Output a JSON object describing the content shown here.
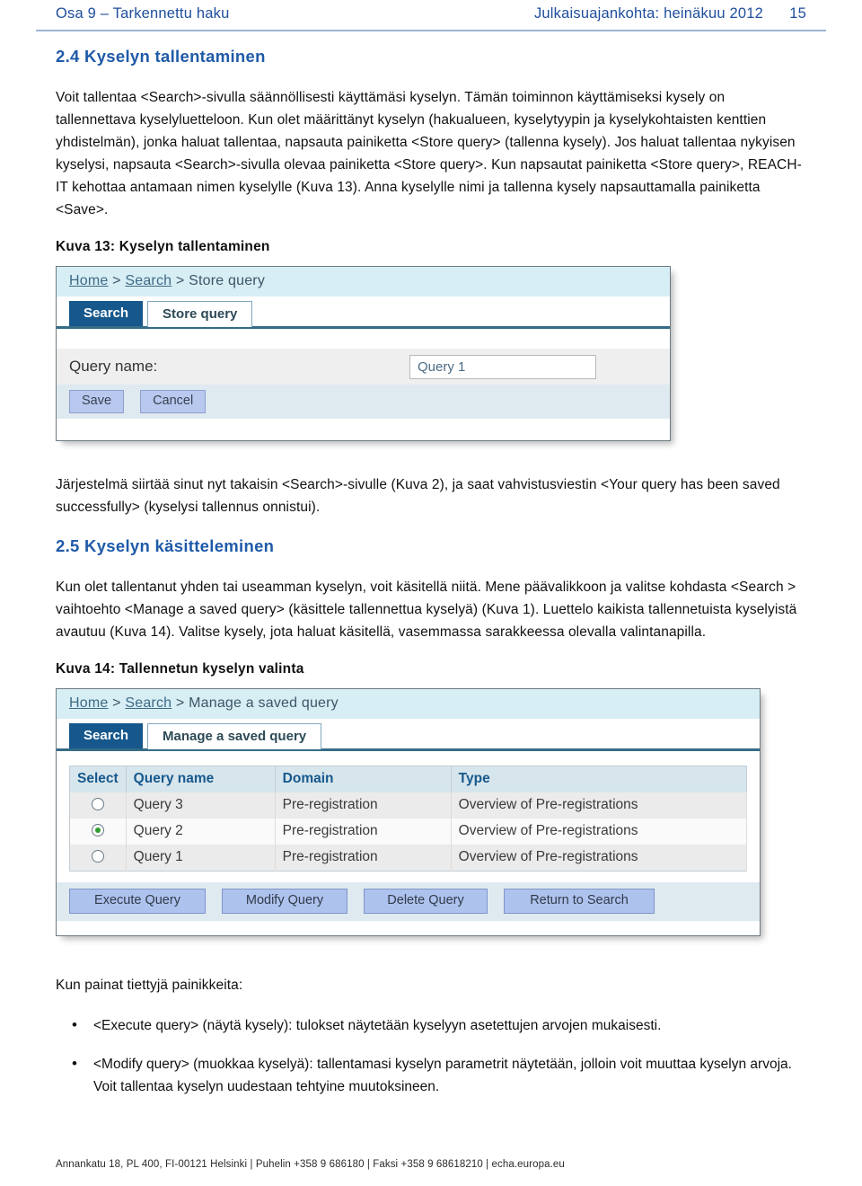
{
  "header": {
    "left": "Osa 9 – Tarkennettu haku",
    "right": "Julkaisuajankohta: heinäkuu 2012",
    "page_number": "15",
    "accent_color": "#1f4e9c"
  },
  "section_24": {
    "heading": "2.4 Kyselyn tallentaminen",
    "paragraph": "Voit tallentaa <Search>-sivulla säännöllisesti käyttämäsi kyselyn. Tämän toiminnon käyttämiseksi kysely on tallennettava kyselyluetteloon. Kun olet määrittänyt kyselyn (hakualueen, kyselytyypin ja kyselykohtaisten kenttien yhdistelmän), jonka haluat tallentaa, napsauta painiketta <Store query> (tallenna kysely). Jos haluat tallentaa nykyisen kyselysi, napsauta <Search>-sivulla olevaa painiketta <Store query>. Kun napsautat painiketta <Store query>, REACH-IT kehottaa antamaan nimen kyselylle (Kuva 13). Anna kyselylle nimi ja tallenna kysely napsauttamalla painiketta <Save>.",
    "figure_caption": "Kuva 13: Kyselyn tallentaminen",
    "after_figure_paragraph": "Järjestelmä siirtää sinut nyt takaisin <Search>-sivulle (Kuva 2), ja saat vahvistusviestin <Your query has been saved successfully> (kyselysi tallennus onnistui)."
  },
  "figure13": {
    "breadcrumb": {
      "home": "Home",
      "sep1": ">",
      "search": "Search",
      "sep2": ">",
      "current": "Store query"
    },
    "tabs": [
      {
        "label": "Search",
        "active": true
      },
      {
        "label": "Store query",
        "active": false
      }
    ],
    "form": {
      "label": "Query name:",
      "value": "Query 1"
    },
    "buttons": [
      {
        "label": "Save"
      },
      {
        "label": "Cancel"
      }
    ]
  },
  "section_25": {
    "heading": "2.5 Kyselyn käsitteleminen",
    "paragraph": "Kun olet tallentanut yhden tai useamman kyselyn, voit käsitellä niitä. Mene päävalikkoon ja valitse kohdasta <Search > vaihtoehto <Manage a saved query> (käsittele tallennettua kyselyä) (Kuva 1). Luettelo kaikista tallennetuista kyselyistä avautuu (Kuva 14). Valitse kysely, jota haluat käsitellä, vasemmassa sarakkeessa olevalla valintanapilla.",
    "figure_caption": "Kuva 14: Tallennetun kyselyn valinta",
    "intro_to_bullets": "Kun painat tiettyjä painikkeita:",
    "bullets": [
      "<Execute query> (näytä kysely): tulokset näytetään kyselyyn asetettujen arvojen mukaisesti.",
      "<Modify query> (muokkaa kyselyä): tallentamasi kyselyn parametrit näytetään, jolloin voit muuttaa kyselyn arvoja. Voit tallentaa kyselyn uudestaan tehtyine muutoksineen."
    ]
  },
  "figure14": {
    "breadcrumb": {
      "home": "Home",
      "sep1": ">",
      "search": "Search",
      "sep2": ">",
      "current": "Manage a saved query"
    },
    "tabs": [
      {
        "label": "Search",
        "active": true
      },
      {
        "label": "Manage a saved query",
        "active": false
      }
    ],
    "table": {
      "columns": [
        "Select",
        "Query name",
        "Domain",
        "Type"
      ],
      "rows": [
        {
          "selected": false,
          "name": "Query 3",
          "domain": "Pre-registration",
          "type": "Overview of Pre-registrations"
        },
        {
          "selected": true,
          "name": "Query 2",
          "domain": "Pre-registration",
          "type": "Overview of Pre-registrations"
        },
        {
          "selected": false,
          "name": "Query 1",
          "domain": "Pre-registration",
          "type": "Overview of Pre-registrations"
        }
      ]
    },
    "buttons": [
      {
        "label": "Execute Query"
      },
      {
        "label": "Modify Query"
      },
      {
        "label": "Delete Query"
      },
      {
        "label": "Return to Search"
      }
    ]
  },
  "footer": {
    "text": "Annankatu 18, PL 400, FI-00121 Helsinki | Puhelin +358 9 686180 | Faksi +358 9 68618210 | echa.europa.eu"
  }
}
